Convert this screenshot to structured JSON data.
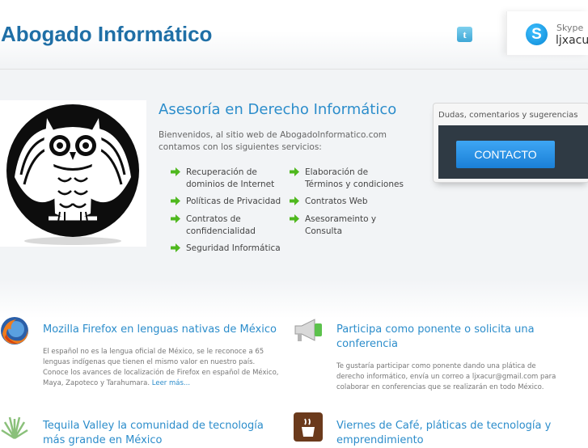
{
  "header": {
    "site_title": "Abogado Informático",
    "twitter_icon": "t",
    "skype_icon": "S",
    "skype_label": "Skype",
    "skype_user": "ljxacur"
  },
  "hero": {
    "title": "Asesoría en Derecho Informático",
    "intro": "Bienvenidos, al sitio web de AbogadoInformatico.com contamos con los siguientes servicios:",
    "services_left": [
      "Recuperación de dominios de Internet",
      "Políticas de Privacidad",
      "Contratos de confidencialidad",
      "Seguridad Informática"
    ],
    "services_right": [
      "Elaboración de Términos y condiciones",
      "Contratos Web",
      "Asesorameinto y Consulta"
    ]
  },
  "contact": {
    "caption": "Dudas, comentarios y sugerencias",
    "button_label": "CONTACTO"
  },
  "articles": [
    {
      "icon": "firefox-icon",
      "title": "Mozilla Firefox en lenguas nativas de México",
      "body": "El español no es la lengua oficial de México, se le reconoce a 65 lenguas indígenas que tienen el mismo valor en nuestro país. Conoce los avances de localización de Firefox en español de México, Maya, Zapoteco y Tarahumara.",
      "read_more": "Leer más..."
    },
    {
      "icon": "megaphone-icon",
      "title": "Participa como ponente o solicita una conferencia",
      "body": "Te gustaría participar como ponente dando una plática de derecho informático, envía un correo a ljxacur@gmail.com para colaborar en conferencias que se realizarán en todo México."
    },
    {
      "icon": "agave-icon",
      "title": "Tequila Valley la comunidad de tecnología más grande en México"
    },
    {
      "icon": "coffee-icon",
      "title": "Viernes de Café, pláticas de tecnología y emprendimiento"
    }
  ],
  "colors": {
    "brand_blue": "#1f6fa6",
    "link_blue": "#2c8dcb",
    "button_blue": "#1a7fd6",
    "arrow_green": "#4fb81e",
    "contact_dark": "#2f3a44"
  }
}
